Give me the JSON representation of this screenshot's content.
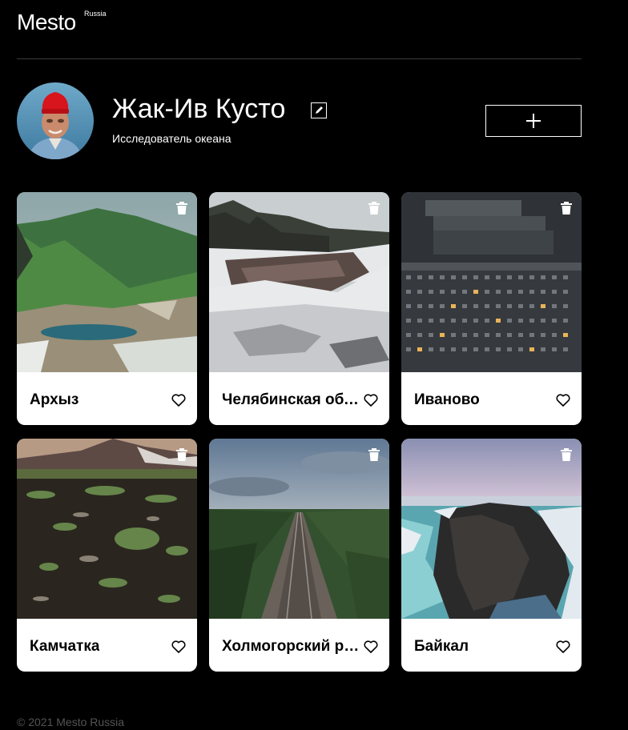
{
  "header": {
    "logo": "Mesto",
    "logo_sup": "Russia"
  },
  "profile": {
    "name": "Жак-Ив Кусто",
    "job": "Исследователь океана"
  },
  "cards": [
    {
      "title": "Архыз"
    },
    {
      "title": "Челябинская область"
    },
    {
      "title": "Иваново"
    },
    {
      "title": "Камчатка"
    },
    {
      "title": "Холмогорский район"
    },
    {
      "title": "Байкал"
    }
  ],
  "footer": {
    "copyright": "© 2021 Mesto Russia"
  },
  "colors": {
    "background": "#000000",
    "card": "#ffffff",
    "footer_text": "#545454",
    "divider": "#545454"
  },
  "icons": {
    "edit": "pencil-edit-icon",
    "add": "plus-icon",
    "delete": "trash-icon",
    "like": "heart-outline-icon"
  }
}
